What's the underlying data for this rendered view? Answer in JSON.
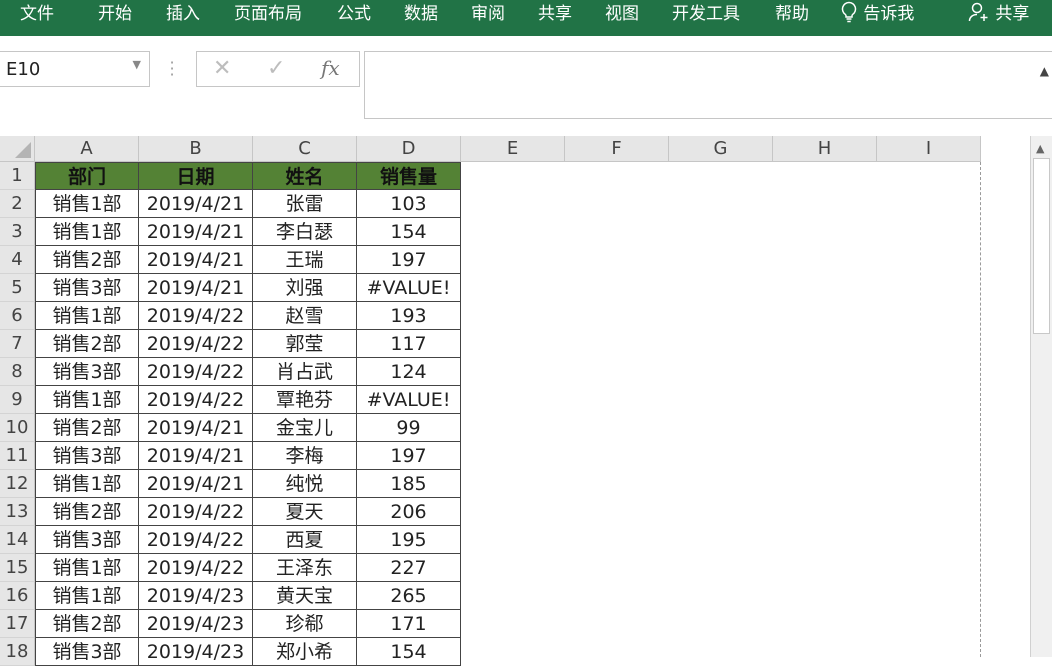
{
  "ribbon": {
    "tabs": [
      "文件",
      "开始",
      "插入",
      "页面布局",
      "公式",
      "数据",
      "审阅",
      "共享",
      "视图",
      "开发工具",
      "帮助"
    ],
    "tell_me": "告诉我",
    "share": "共享",
    "background": "#217346"
  },
  "formula_bar": {
    "name_box": "E10",
    "formula": "",
    "cancel_symbol": "✕",
    "enter_symbol": "✓",
    "fx_symbol": "fx"
  },
  "sheet": {
    "columns": [
      "A",
      "B",
      "C",
      "D",
      "E",
      "F",
      "G",
      "H",
      "I"
    ],
    "row_numbers": [
      "1",
      "2",
      "3",
      "4",
      "5",
      "6",
      "7",
      "8",
      "9",
      "10",
      "11",
      "12",
      "13",
      "14",
      "15",
      "16",
      "17",
      "18"
    ],
    "header_fill": "#548235",
    "headers": [
      "部门",
      "日期",
      "姓名",
      "销售量"
    ],
    "rows": [
      [
        "销售1部",
        "2019/4/21",
        "张雷",
        "103"
      ],
      [
        "销售1部",
        "2019/4/21",
        "李白瑟",
        "154"
      ],
      [
        "销售2部",
        "2019/4/21",
        "王瑞",
        "197"
      ],
      [
        "销售3部",
        "2019/4/21",
        "刘强",
        "#VALUE!"
      ],
      [
        "销售1部",
        "2019/4/22",
        "赵雪",
        "193"
      ],
      [
        "销售2部",
        "2019/4/22",
        "郭莹",
        "117"
      ],
      [
        "销售3部",
        "2019/4/22",
        "肖占武",
        "124"
      ],
      [
        "销售1部",
        "2019/4/22",
        "覃艳芬",
        "#VALUE!"
      ],
      [
        "销售2部",
        "2019/4/21",
        "金宝儿",
        "99"
      ],
      [
        "销售3部",
        "2019/4/21",
        "李梅",
        "197"
      ],
      [
        "销售1部",
        "2019/4/21",
        "纯悦",
        "185"
      ],
      [
        "销售2部",
        "2019/4/22",
        "夏天",
        "206"
      ],
      [
        "销售3部",
        "2019/4/22",
        "西夏",
        "195"
      ],
      [
        "销售1部",
        "2019/4/22",
        "王泽东",
        "227"
      ],
      [
        "销售1部",
        "2019/4/23",
        "黄天宝",
        "265"
      ],
      [
        "销售2部",
        "2019/4/23",
        "珍郗",
        "171"
      ],
      [
        "销售3部",
        "2019/4/23",
        "郑小希",
        "154"
      ]
    ]
  }
}
